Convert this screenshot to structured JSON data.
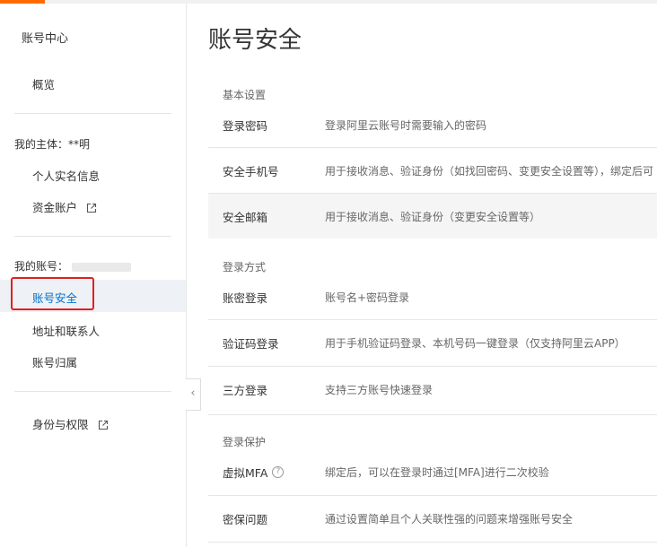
{
  "sidebar": {
    "title": "账号中心",
    "overview": "概览",
    "subject_label": "我的主体：**明",
    "real_name": "个人实名信息",
    "fund_account": "资金账户",
    "my_account_label": "我的账号：",
    "account_security": "账号安全",
    "address_contacts": "地址和联系人",
    "account_ownership": "账号归属",
    "identity_permissions": "身份与权限"
  },
  "page": {
    "title": "账号安全"
  },
  "groups": {
    "basic": "基本设置",
    "login_methods": "登录方式",
    "login_protection": "登录保护"
  },
  "rows": [
    {
      "name": "登录密码",
      "desc": "登录阿里云账号时需要输入的密码"
    },
    {
      "name": "安全手机号",
      "desc": "用于接收消息、验证身份（如找回密码、变更安全设置等），绑定后可"
    },
    {
      "name": "安全邮箱",
      "desc": "用于接收消息、验证身份（变更安全设置等）"
    },
    {
      "name": "账密登录",
      "desc": "账号名+密码登录"
    },
    {
      "name": "验证码登录",
      "desc": "用于手机验证码登录、本机号码一键登录（仅支持阿里云APP）"
    },
    {
      "name": "三方登录",
      "desc": "支持三方账号快速登录"
    },
    {
      "name": "虚拟MFA",
      "desc": "绑定后，可以在登录时通过[MFA]进行二次校验"
    },
    {
      "name": "密保问题",
      "desc": "通过设置简单且个人关联性强的问题来增强账号安全"
    }
  ],
  "icons": {
    "external": "external-link-icon",
    "collapse": "chevron-left-icon",
    "help": "question-circle-icon"
  },
  "colors": {
    "accent": "#ff6a00",
    "active": "#0070cc",
    "highlight": "#e02020"
  }
}
